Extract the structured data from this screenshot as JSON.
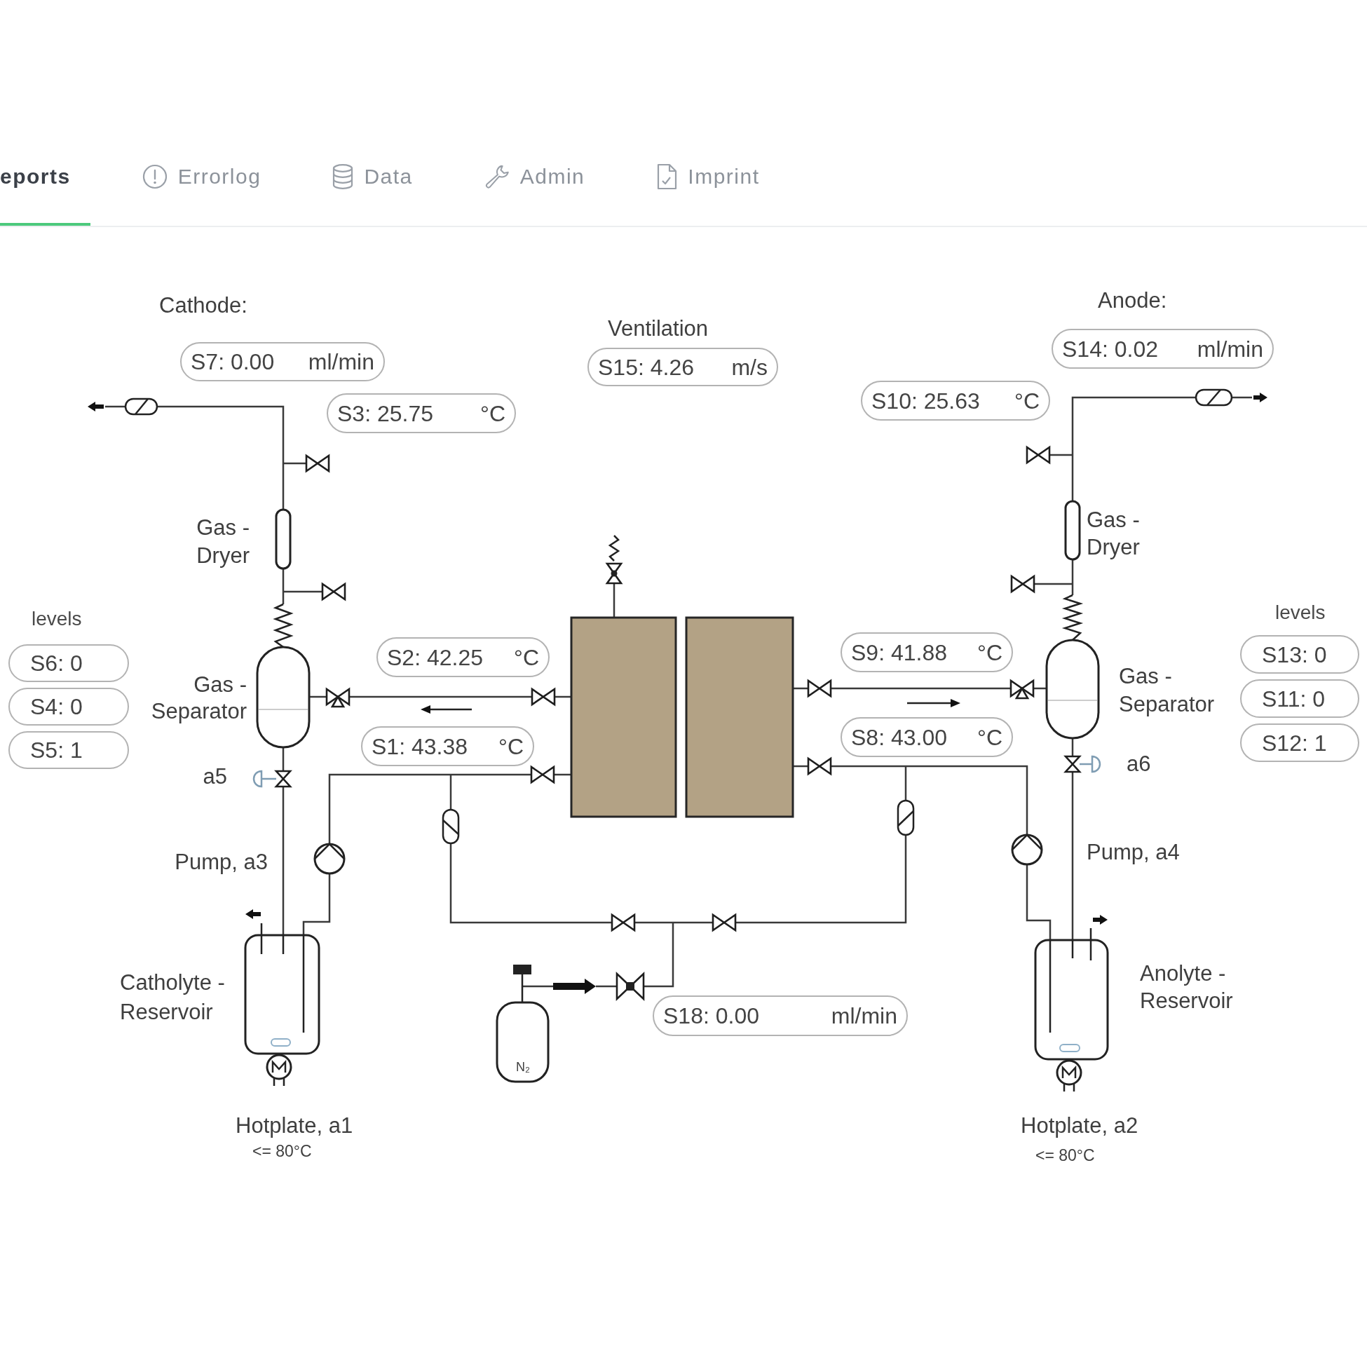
{
  "tabs": [
    {
      "label": "eports",
      "selected": true
    },
    {
      "label": "Errorlog",
      "selected": false
    },
    {
      "label": "Data",
      "selected": false
    },
    {
      "label": "Admin",
      "selected": false
    },
    {
      "label": "Imprint",
      "selected": false
    }
  ],
  "sides": [
    {
      "title": "Cathode:",
      "gas_flow_readout": {
        "reading": "S7: 0.00",
        "unit": "ml/min"
      },
      "gas_temperature_readout": {
        "reading": "S3: 25.75",
        "unit": "°C"
      },
      "dryer_label": "Gas -\nDryer",
      "level_title": "levels",
      "levels": [
        "S6: 0",
        "S4: 0",
        "S5: 1"
      ],
      "separator_label": "Gas -\nSeparator",
      "upper_pipe_readout": {
        "reading": "S2: 42.25",
        "unit": "°C"
      },
      "lower_pipe_readout": {
        "reading": "S1: 43.38",
        "unit": "°C"
      },
      "valve_label": "a5",
      "pump_label": "Pump, a3",
      "reservoir_label": "Catholyte -\nReservoir",
      "hotplate_label": "Hotplate, a1",
      "hotplate_limit": "<= 80°C"
    },
    {
      "title": "Anode:",
      "gas_flow_readout": {
        "reading": "S14: 0.02",
        "unit": "ml/min"
      },
      "gas_temperature_readout": {
        "reading": "S10: 25.63",
        "unit": "°C"
      },
      "dryer_label": "Gas -\nDryer",
      "level_title": "levels",
      "levels": [
        "S13: 0",
        "S11: 0",
        "S12: 1"
      ],
      "separator_label": "Gas -\nSeparator",
      "upper_pipe_readout": {
        "reading": "S9: 41.88",
        "unit": "°C"
      },
      "lower_pipe_readout": {
        "reading": "S8: 43.00",
        "unit": "°C"
      },
      "valve_label": "a6",
      "pump_label": "Pump, a4",
      "reservoir_label": "Anolyte -\nReservoir",
      "hotplate_label": "Hotplate, a2",
      "hotplate_limit": "<= 80°C"
    }
  ],
  "ventilation": {
    "title": "Ventilation",
    "readout": {
      "reading": "S15: 4.26",
      "unit": "m/s"
    }
  },
  "nitrogen": {
    "bottle_label": "N₂",
    "readout": {
      "reading": "S18: 0.00",
      "unit": "ml/min"
    }
  }
}
